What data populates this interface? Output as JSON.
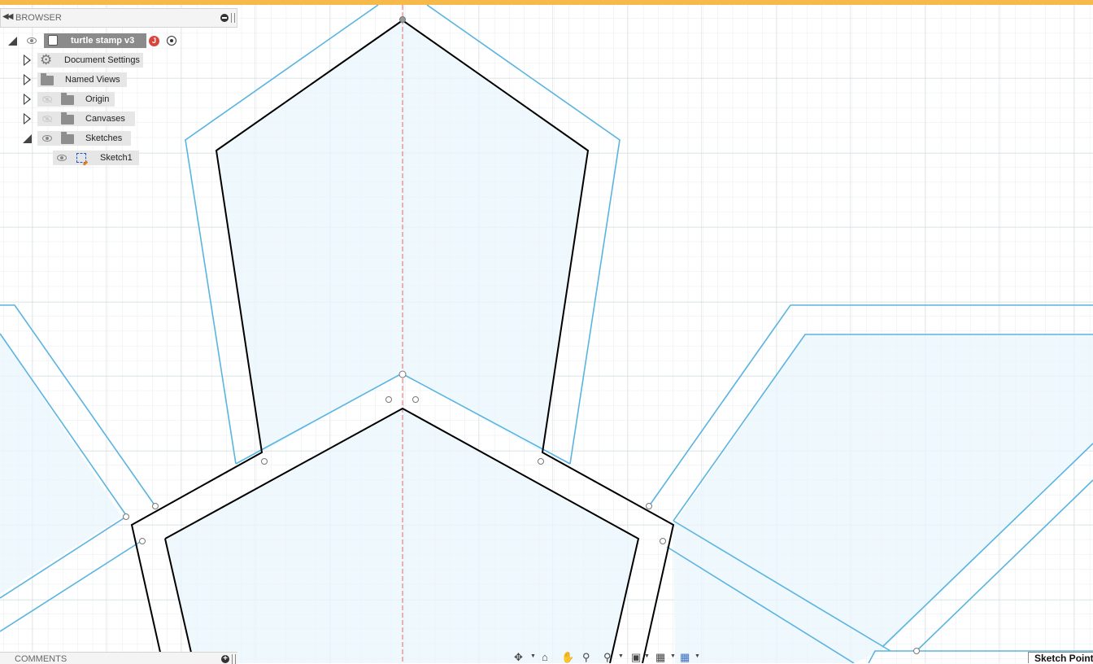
{
  "browser": {
    "title": "BROWSER",
    "root": {
      "label": "turtle stamp v3",
      "badge": "J"
    },
    "items": [
      {
        "label": "Document Settings",
        "icon": "gear-icon"
      },
      {
        "label": "Named Views",
        "icon": "folder-icon"
      },
      {
        "label": "Origin",
        "icon": "folder-icon",
        "visibility": "hidden"
      },
      {
        "label": "Canvases",
        "icon": "folder-icon",
        "visibility": "hidden"
      },
      {
        "label": "Sketches",
        "icon": "folder-icon",
        "visibility": "visible",
        "expanded": true
      }
    ],
    "sketches": [
      {
        "label": "Sketch1",
        "icon": "sketch-icon"
      }
    ]
  },
  "comments": {
    "title": "COMMENTS"
  },
  "nav_toolbar": {
    "tools": [
      "orbit-icon",
      "look-at-icon",
      "pan-icon",
      "zoom-icon",
      "fit-icon",
      "display-settings-icon",
      "grid-settings-icon",
      "viewports-icon"
    ]
  },
  "status": {
    "text": "Sketch Point"
  },
  "colors": {
    "accent_bar": "#f7b94a",
    "construction_line": "#5ab4e0",
    "sketch_fill": "#eaf5fc",
    "profile_line": "#000000",
    "axis": "#e05a5a"
  }
}
